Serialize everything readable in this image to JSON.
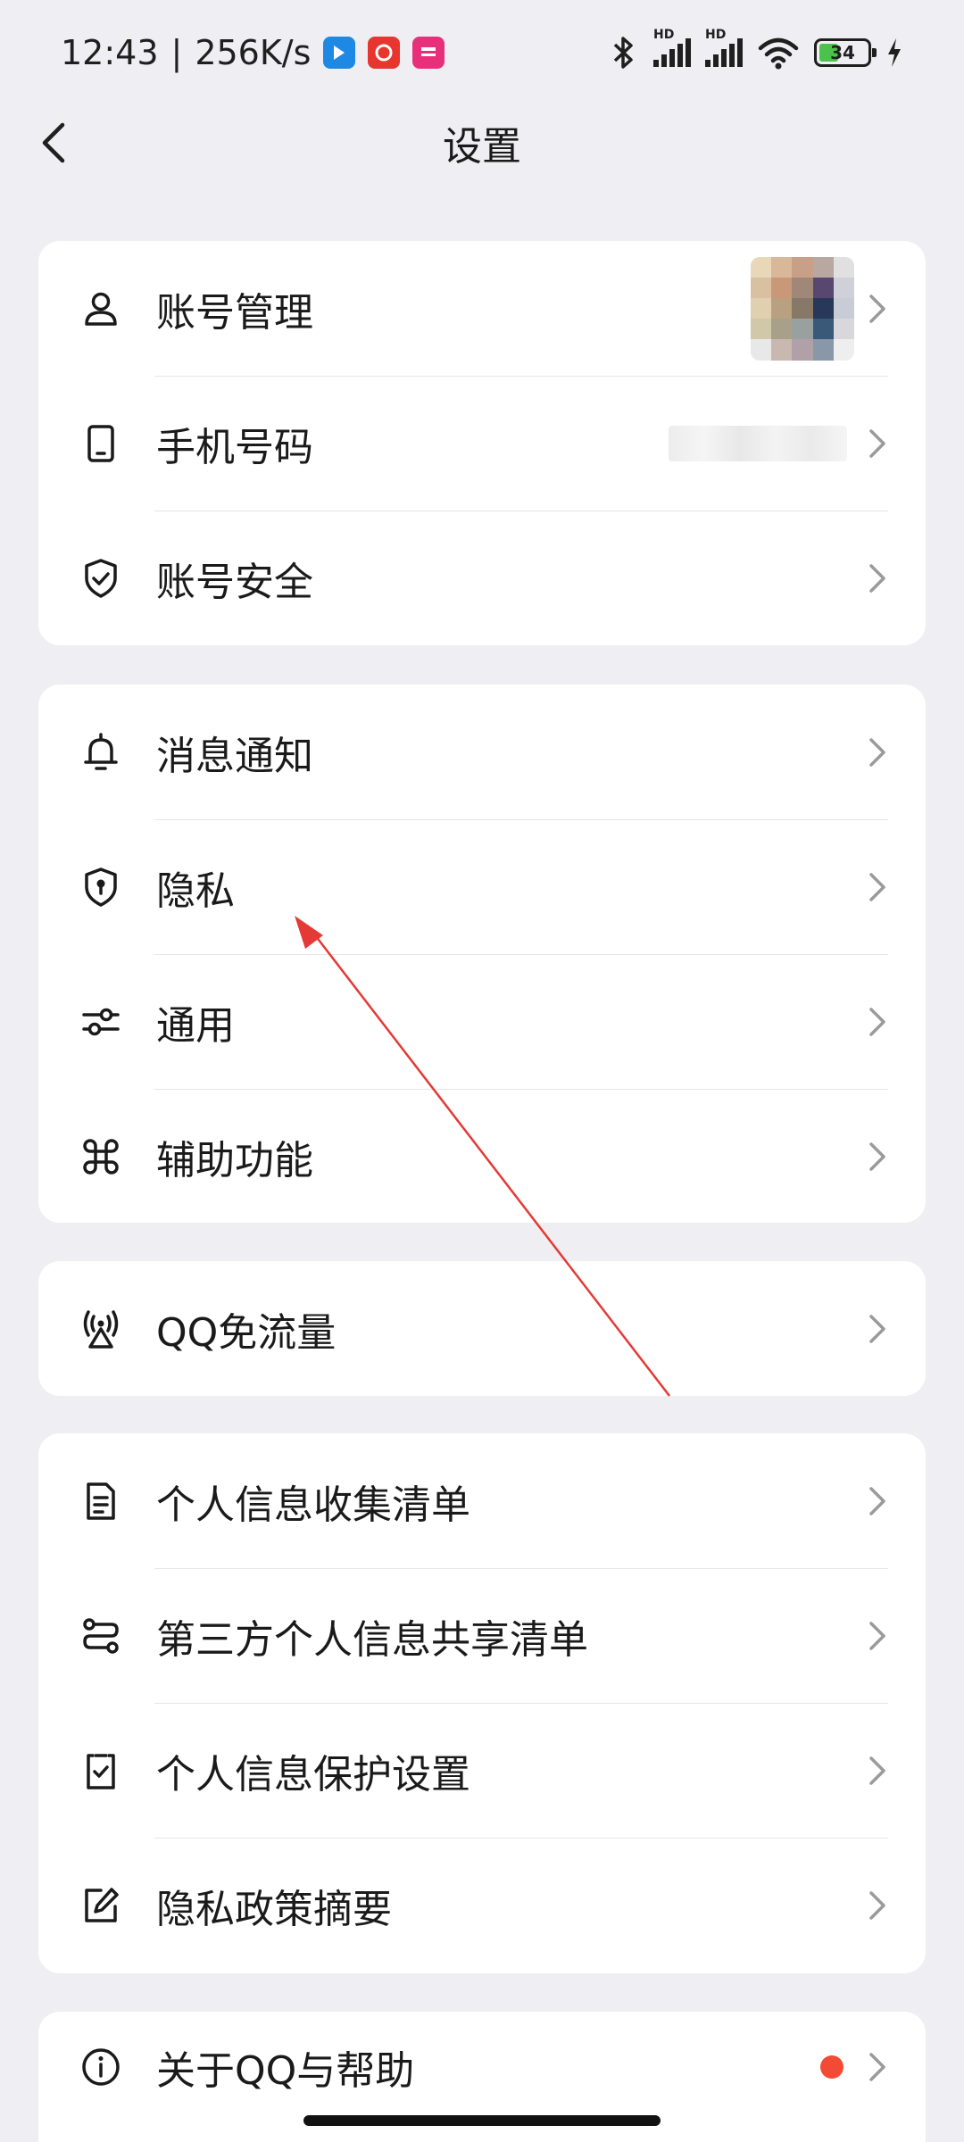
{
  "status_bar": {
    "time": "12:43",
    "net_speed": "256K/s",
    "hd1": "HD",
    "hd2": "HD",
    "battery": "34",
    "app_badges": [
      {
        "name": "blue-app-icon",
        "color": "#1E88E5"
      },
      {
        "name": "taobao-app-icon",
        "color": "#E8352E"
      },
      {
        "name": "vip-app-icon",
        "color": "#E8307A"
      }
    ]
  },
  "header": {
    "title": "设置"
  },
  "cards": [
    {
      "rows": [
        {
          "label": "账号管理",
          "icon": "person-icon"
        },
        {
          "label": "手机号码",
          "icon": "phone-icon"
        },
        {
          "label": "账号安全",
          "icon": "shield-check-icon"
        }
      ]
    },
    {
      "rows": [
        {
          "label": "消息通知",
          "icon": "bell-icon"
        },
        {
          "label": "隐私",
          "icon": "shield-lock-icon"
        },
        {
          "label": "通用",
          "icon": "sliders-icon"
        },
        {
          "label": "辅助功能",
          "icon": "command-icon"
        }
      ]
    },
    {
      "rows": [
        {
          "label": "QQ免流量",
          "icon": "signal-tower-icon"
        }
      ]
    },
    {
      "rows": [
        {
          "label": "个人信息收集清单",
          "icon": "document-icon"
        },
        {
          "label": "第三方个人信息共享清单",
          "icon": "share-list-icon"
        },
        {
          "label": "个人信息保护设置",
          "icon": "clipboard-check-icon"
        },
        {
          "label": "隐私政策摘要",
          "icon": "edit-icon"
        }
      ]
    },
    {
      "rows": [
        {
          "label": "关于QQ与帮助",
          "icon": "info-icon"
        }
      ]
    }
  ],
  "colors": {
    "background": "#EEEEF3",
    "card": "#FFFFFF",
    "notification_dot": "#F24A35",
    "annotation_arrow": "#E53935"
  }
}
